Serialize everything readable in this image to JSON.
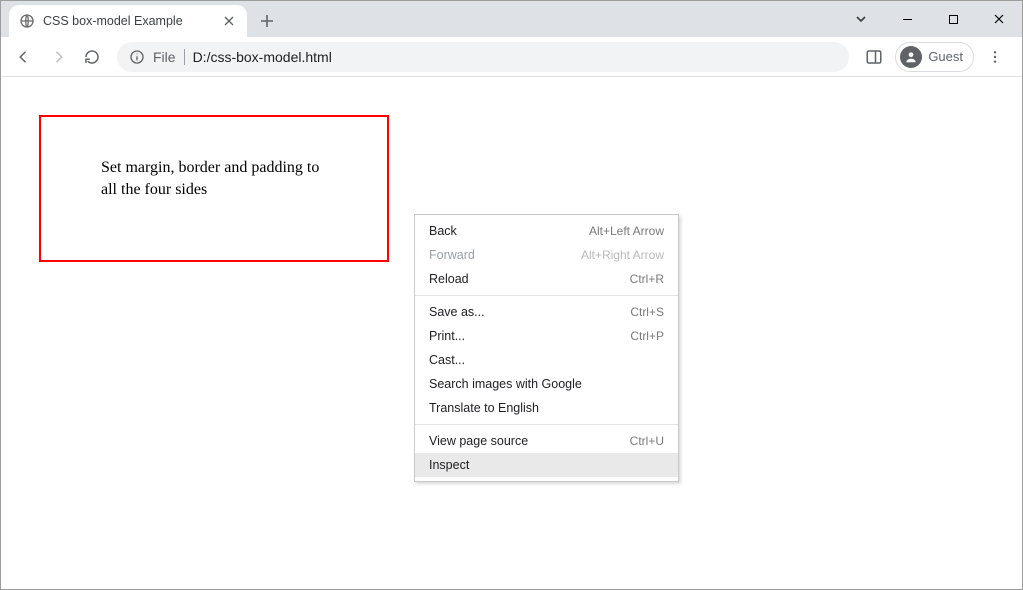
{
  "tab": {
    "title": "CSS box-model Example"
  },
  "address": {
    "scheme": "File",
    "path": "D:/css-box-model.html"
  },
  "guest_label": "Guest",
  "page": {
    "box_text": "Set margin, border and padding to all the four sides"
  },
  "context_menu": {
    "items": [
      {
        "label": "Back",
        "shortcut": "Alt+Left Arrow",
        "disabled": false
      },
      {
        "label": "Forward",
        "shortcut": "Alt+Right Arrow",
        "disabled": true
      },
      {
        "label": "Reload",
        "shortcut": "Ctrl+R",
        "disabled": false
      }
    ],
    "items2": [
      {
        "label": "Save as...",
        "shortcut": "Ctrl+S"
      },
      {
        "label": "Print...",
        "shortcut": "Ctrl+P"
      },
      {
        "label": "Cast...",
        "shortcut": ""
      },
      {
        "label": "Search images with Google",
        "shortcut": ""
      },
      {
        "label": "Translate to English",
        "shortcut": ""
      }
    ],
    "items3": [
      {
        "label": "View page source",
        "shortcut": "Ctrl+U"
      },
      {
        "label": "Inspect",
        "shortcut": "",
        "hover": true
      }
    ]
  }
}
